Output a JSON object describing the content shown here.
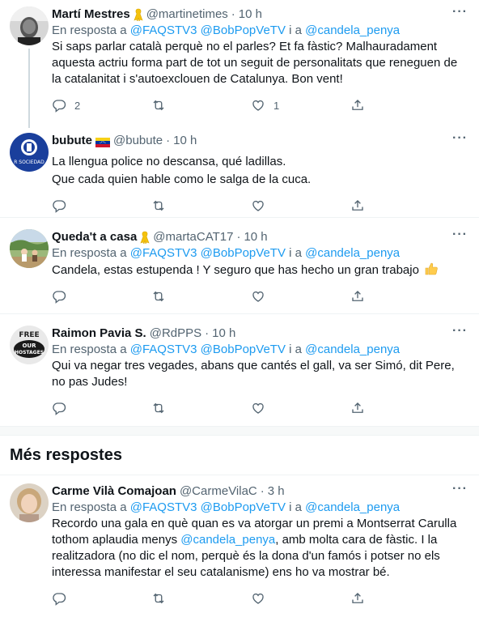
{
  "colors": {
    "link": "#1d9bf0",
    "muted": "#536471",
    "text": "#0f1419",
    "divider": "#eff3f4"
  },
  "tweets": [
    {
      "name": "Martí Mestres",
      "handle": "@martinetimes",
      "time": "10 h",
      "badge_icon": "yellow-ribbon-icon",
      "reply_prefix": "En resposta a",
      "mention1": "@FAQSTV3",
      "mention2": "@BobPopVeTV",
      "reply_and": "i a",
      "mention3": "@candela_penya",
      "text": "Si saps parlar català perquè no el parles? Et fa fàstic? Malhauradament aquesta actriu forma part de tot un seguit de personalitats que reneguen de la catalanitat i s'autoexclouen de Catalunya. Bon vent!",
      "reply_count": "2",
      "retweet_count": "",
      "like_count": "1"
    },
    {
      "name": "bubute",
      "handle": "@bubute",
      "time": "10 h",
      "badge_icon": "venezuela-flag-icon",
      "avatar_text": "R SOCIEDAD",
      "line1": "La llengua police no descansa, qué ladillas.",
      "line2": "Que cada quien hable como le salga de la cuca.",
      "reply_count": "",
      "retweet_count": "",
      "like_count": ""
    },
    {
      "name": "Queda't a casa",
      "handle": "@martaCAT17",
      "time": "10 h",
      "badge_icon": "yellow-ribbon-icon",
      "reply_prefix": "En resposta a",
      "mention1": "@FAQSTV3",
      "mention2": "@BobPopVeTV",
      "reply_and": "i a",
      "mention3": "@candela_penya",
      "text": "Candela, estas estupenda ! Y seguro que has hecho un gran trabajo",
      "text_emoji": "thumbs-up-icon",
      "reply_count": "",
      "retweet_count": "",
      "like_count": ""
    },
    {
      "name": "Raimon Pavia S.",
      "handle": "@RdPPS",
      "time": "10 h",
      "avatar_text1": "FREE",
      "avatar_text2": "OUR",
      "avatar_text3": "HOSTAGES",
      "reply_prefix": "En resposta a",
      "mention1": "@FAQSTV3",
      "mention2": "@BobPopVeTV",
      "reply_and": "i a",
      "mention3": "@candela_penya",
      "text": "Qui va negar tres vegades, abans que cantés el gall, va ser Simó, dit Pere, no pas Judes!",
      "reply_count": "",
      "retweet_count": "",
      "like_count": ""
    }
  ],
  "more_replies_title": "Més respostes",
  "last_tweet": {
    "name": "Carme Vilà Comajoan",
    "handle": "@CarmeVilaC",
    "time": "3 h",
    "reply_prefix": "En resposta a",
    "mention1": "@FAQSTV3",
    "mention2": "@BobPopVeTV",
    "reply_and": "i a",
    "mention3": "@candela_penya",
    "text_before": "Recordo una gala en què quan es va atorgar un premi a Montserrat Carulla tothom aplaudia menys ",
    "text_mention": "@candela_penya",
    "text_after": ", amb molta cara de fàstic. I la realitzadora (no dic el nom, perquè és la dona d'un famós i potser no els interessa manifestar el seu catalanisme) ens ho va mostrar bé.",
    "reply_count": "",
    "retweet_count": "",
    "like_count": ""
  },
  "more_glyph": "···",
  "dot_glyph": "·"
}
